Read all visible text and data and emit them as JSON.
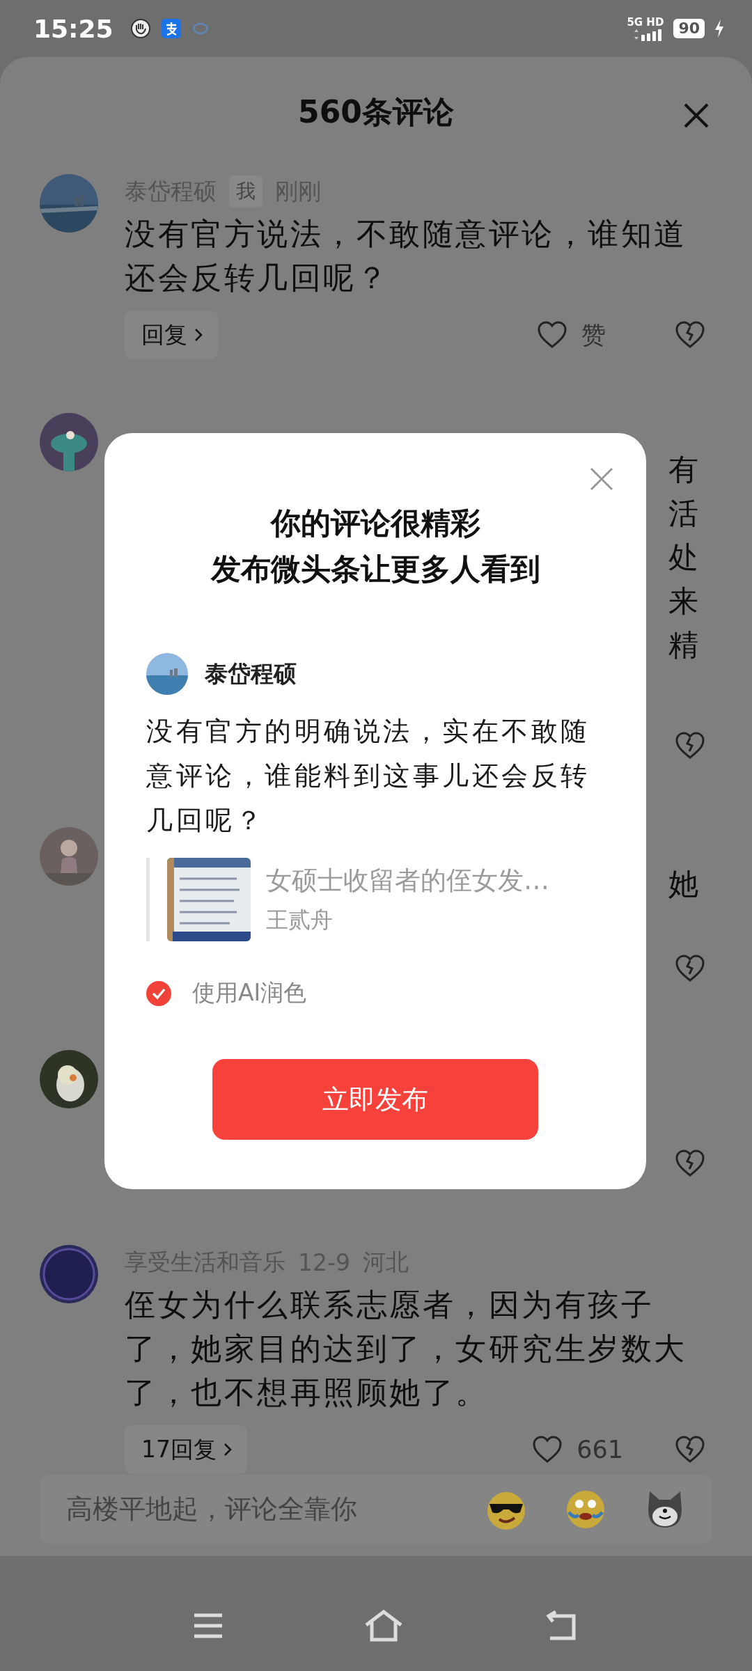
{
  "status_bar": {
    "time": "15:25",
    "network": "5G HD",
    "battery": "90"
  },
  "sheet": {
    "title": "560条评论"
  },
  "comments": [
    {
      "kind": "full",
      "author": "泰岱程硕",
      "tag": "我",
      "meta": [
        "刚刚"
      ],
      "text": "没有官方说法，不敢随意评论，谁知道还会反转几回呢？",
      "reply": "回复",
      "like": "赞"
    },
    {
      "kind": "covered",
      "fragments": [
        "有",
        "活",
        "处",
        "来",
        "精"
      ]
    },
    {
      "kind": "covered",
      "fragments": [
        "她"
      ]
    },
    {
      "kind": "covered"
    },
    {
      "kind": "full",
      "author": "享受生活和音乐",
      "meta": [
        "12-9",
        "河北"
      ],
      "text": "侄女为什么联系志愿者，因为有孩子了，她家目的达到了，女研究生岁数大了，也不想再照顾她了。",
      "reply": "17回复",
      "like": "661"
    }
  ],
  "input_bar": {
    "placeholder": "高楼平地起，评论全靠你"
  },
  "modal": {
    "title_lines": [
      "你的评论很精彩",
      "发布微头条让更多人看到"
    ],
    "author": "泰岱程硕",
    "text": "没有官方的明确说法，实在不敢随意评论，谁能料到这事儿还会反转几回呢？",
    "quote": {
      "title": "女硕士收留者的侄女发…",
      "author": "王贰舟"
    },
    "ai_polish": {
      "label": "使用AI润色",
      "checked": true
    },
    "publish_button": "立即发布"
  }
}
